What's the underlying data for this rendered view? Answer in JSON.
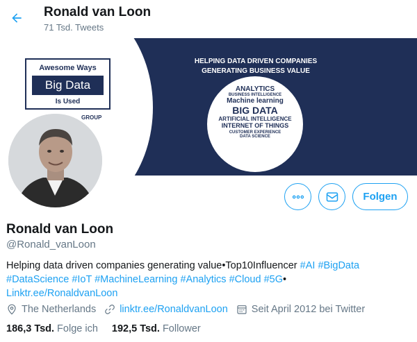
{
  "header": {
    "title": "Ronald van Loon",
    "tweet_count": "71 Tsd. Tweets"
  },
  "banner": {
    "book_line1": "Awesome Ways",
    "book_line2": "Big Data",
    "book_line3": "Is Used",
    "group_text": "GROUP",
    "headline_1": "HELPING DATA DRIVEN COMPANIES",
    "headline_2": "GENERATING BUSINESS VALUE",
    "circle_lines": [
      "ANALYTICS",
      "BUSINESS INTELLIGENCE",
      "Machine learning",
      "BIG DATA",
      "ARTIFICIAL INTELLIGENCE",
      "INTERNET OF THINGS",
      "CUSTOMER EXPERIENCE",
      "DATA SCIENCE"
    ]
  },
  "actions": {
    "more_label": "More options",
    "message_label": "Message",
    "follow_label": "Folgen"
  },
  "profile": {
    "name": "Ronald van Loon",
    "handle": "@Ronald_vanLoon",
    "bio_text": "Helping data driven companies generating value•Top10Influencer ",
    "bio_tags_1": [
      "#AI",
      "#BigData"
    ],
    "bio_tags_2": [
      "#DataScience",
      "#IoT",
      "#MachineLearning",
      "#Analytics",
      "#Cloud",
      "#5G"
    ],
    "bio_bullet": "•",
    "bio_link": "Linktr.ee/RonaldvanLoon",
    "location": "The Netherlands",
    "website": "linktr.ee/RonaldvanLoon",
    "joined": "Seit April 2012 bei Twitter"
  },
  "stats": {
    "following_count": "186,3 Tsd.",
    "following_label": "Folge ich",
    "followers_count": "192,5 Tsd.",
    "followers_label": "Follower"
  },
  "colors": {
    "accent": "#1da1f2",
    "banner_bg": "#1f2f57",
    "muted": "#657786"
  },
  "icons": [
    "back-arrow-icon",
    "more-icon",
    "mail-icon",
    "location-icon",
    "link-icon",
    "calendar-icon"
  ]
}
